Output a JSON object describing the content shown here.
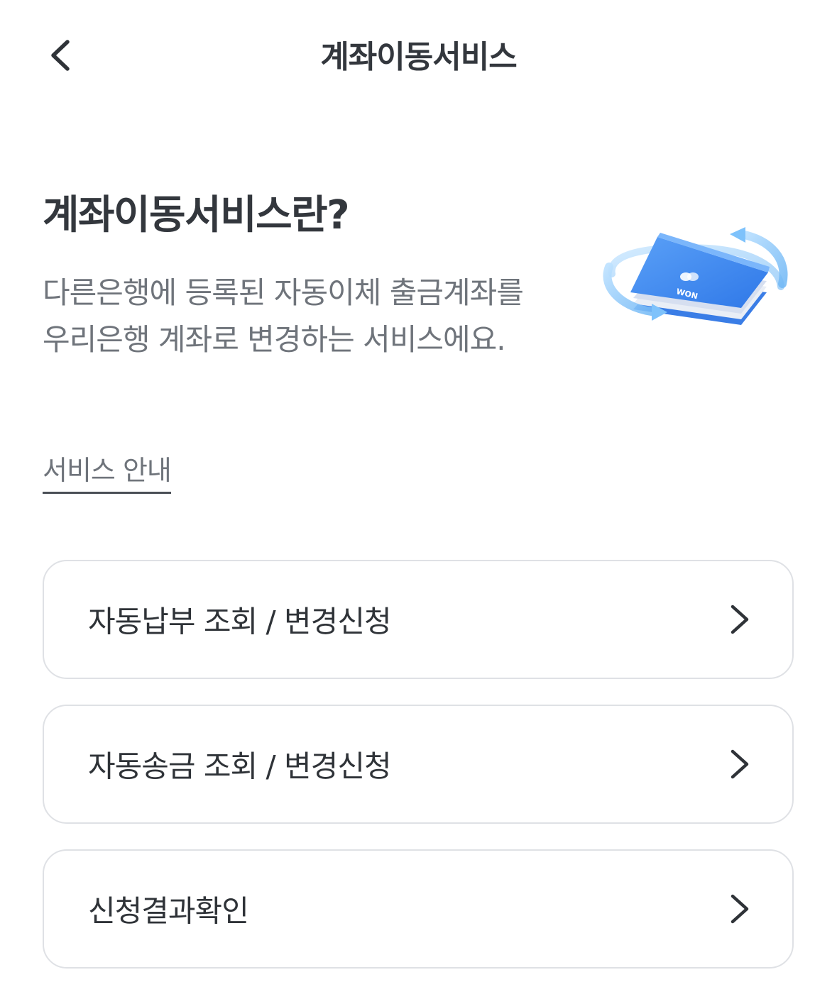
{
  "header": {
    "title": "계좌이동서비스",
    "back_icon": "chevron-left-icon"
  },
  "intro": {
    "title": "계좌이동서비스란?",
    "description": "다른은행에 등록된 자동이체 출금계좌를 우리은행 계좌로 변경하는 서비스에요.",
    "illustration_text": "WON",
    "illustration_icon": "account-transfer-illustration"
  },
  "service_guide": {
    "label": "서비스 안내"
  },
  "menu": [
    {
      "label": "자동납부 조회 / 변경신청",
      "icon": "chevron-right-icon"
    },
    {
      "label": "자동송금 조회 / 변경신청",
      "icon": "chevron-right-icon"
    },
    {
      "label": "신청결과확인",
      "icon": "chevron-right-icon"
    }
  ],
  "colors": {
    "text_primary": "#33373d",
    "text_secondary": "#6f747b",
    "border": "#dfe1e5",
    "illustration_blue": "#3d86f0"
  }
}
